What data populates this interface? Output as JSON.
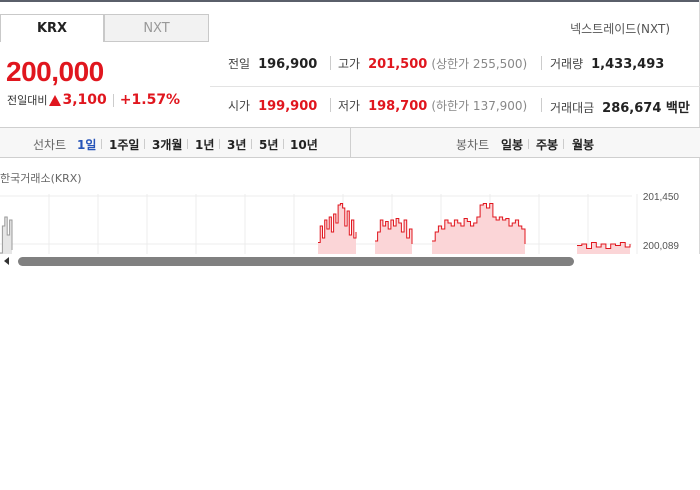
{
  "tabs": {
    "krx": "KRX",
    "nxt": "NXT"
  },
  "nextrade_link": "넥스트레이드(NXT)",
  "price": "200,000",
  "change": {
    "label": "전일대비",
    "amount": "3,100",
    "percent": "+1.57%",
    "direction": "up"
  },
  "stats": {
    "prev_close": {
      "label": "전일",
      "value": "196,900"
    },
    "high": {
      "label": "고가",
      "value": "201,500",
      "note": "(상한가 255,500)"
    },
    "volume": {
      "label": "거래량",
      "value": "1,433,493"
    },
    "open": {
      "label": "시가",
      "value": "199,900"
    },
    "low": {
      "label": "저가",
      "value": "198,700",
      "note": "(하한가 137,900)"
    },
    "amount": {
      "label": "거래대금",
      "value": "286,674 백만"
    }
  },
  "toolbar": {
    "line_chart_label": "선차트",
    "periods": [
      "1일",
      "1주일",
      "3개월",
      "1년",
      "3년",
      "5년",
      "10년"
    ],
    "active_period": "1일",
    "candle_chart_label": "봉차트",
    "candles": [
      "일봉",
      "주봉",
      "월봉"
    ]
  },
  "chart_caption": "한국거래소(KRX)",
  "chart_data": {
    "type": "area",
    "y_ticks": [
      "201,450",
      "200,089"
    ],
    "ylim": [
      199700,
      201700
    ],
    "series_color": "#e0161e",
    "fill_color": "#fbd5d7",
    "segments": [
      {
        "x0": 318,
        "x1": 356,
        "values": [
          200150,
          200700,
          200300,
          200900,
          200600,
          201000,
          200500,
          201100,
          200800,
          201400,
          201450,
          201300,
          200700,
          201200,
          200400,
          200900,
          200300,
          200500
        ]
      },
      {
        "x0": 375,
        "x1": 412,
        "values": [
          200200,
          200500,
          200900,
          200700,
          200850,
          200600,
          200900,
          200700,
          200950,
          200800,
          200500,
          200900,
          200300,
          200600,
          200100
        ]
      },
      {
        "x0": 432,
        "x1": 525,
        "values": [
          200200,
          200500,
          200700,
          200600,
          200900,
          200800,
          200700,
          200900,
          200800,
          200700,
          200950,
          200850,
          200700,
          200800,
          201000,
          201400,
          201450,
          201300,
          201450,
          201000,
          200900,
          201000,
          200900,
          200950,
          200700,
          200800,
          200900,
          200700,
          200600,
          200100
        ]
      },
      {
        "x0": 577,
        "x1": 630,
        "values": [
          200050,
          200100,
          199950,
          200150,
          200000,
          200100,
          199950,
          200100,
          200050,
          200150,
          200000,
          200100
        ]
      }
    ],
    "left_spike": {
      "x0": 0,
      "x1": 12,
      "values": [
        199800,
        200700,
        201000,
        200400,
        200900,
        199900
      ]
    },
    "grid": true
  }
}
